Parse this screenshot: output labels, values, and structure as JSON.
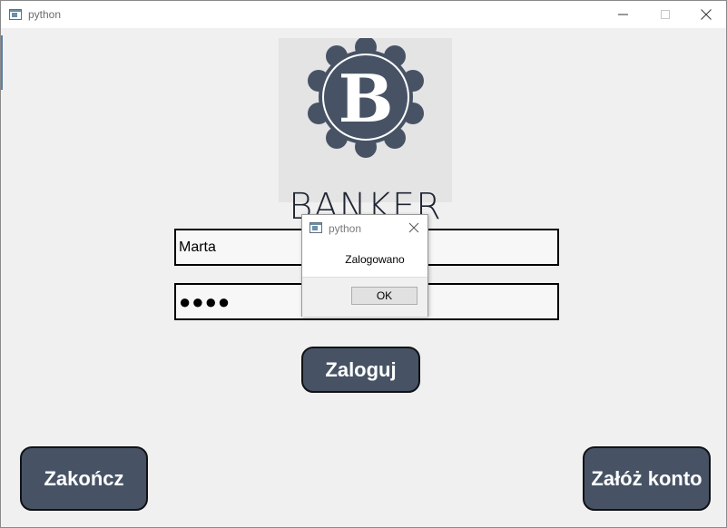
{
  "window": {
    "title": "python"
  },
  "logo": {
    "text": "BANKER",
    "letter": "B",
    "colors": {
      "badge": "#475365",
      "background": "#e4e4e4",
      "text": "#1f2533"
    }
  },
  "form": {
    "username_value": "Marta",
    "password_value": "●●●●"
  },
  "buttons": {
    "login": "Zaloguj",
    "exit": "Zakończ",
    "create_account": "Załóż konto"
  },
  "dialog": {
    "title": "python",
    "message": "Zalogowano",
    "ok": "OK"
  },
  "icons": [
    "app-icon",
    "minimize-icon",
    "maximize-icon",
    "close-icon"
  ],
  "colors": {
    "button": "#475365",
    "button_text": "#ffffff",
    "window_bg": "#f0f0f0"
  }
}
